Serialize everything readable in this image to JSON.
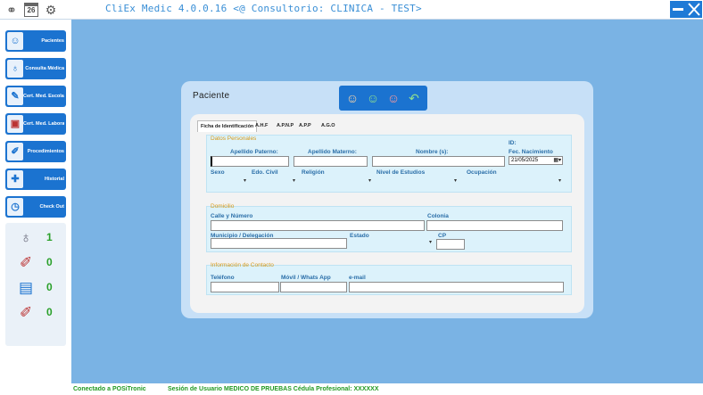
{
  "titlebar": {
    "title": "CliEx Medic 4.0.0.16 <@ Consultorio: CLINICA - TEST>",
    "calendar_day": "26",
    "minimize_icon": "minimize-icon",
    "close_icon": "close-icon"
  },
  "sidebar": {
    "items": [
      {
        "label": "Pacientes",
        "icon": "patient-icon"
      },
      {
        "label": "Consulta Médica",
        "icon": "stethoscope-icon"
      },
      {
        "label": "Cert. Med. Escolar",
        "icon": "school-certificate-icon"
      },
      {
        "label": "Cert. Med. Laboral",
        "icon": "briefcase-icon"
      },
      {
        "label": "Procedimientos",
        "icon": "syringe-icon"
      },
      {
        "label": "Historial",
        "icon": "history-icon"
      },
      {
        "label": "Check Out",
        "icon": "clock-icon"
      }
    ],
    "stats": [
      {
        "value": "1",
        "icon": "stethoscope-icon"
      },
      {
        "value": "0",
        "icon": "syringe-icon"
      },
      {
        "value": "0",
        "icon": "id-card-icon"
      },
      {
        "value": "0",
        "icon": "injection-icon"
      }
    ]
  },
  "panel": {
    "title": "Paciente",
    "toolbar": [
      "new-patient-icon",
      "save-patient-icon",
      "delete-patient-icon",
      "undo-icon"
    ],
    "tabs": [
      "Ficha de Identificación",
      "A.H.F",
      "A.P.N.P",
      "A.P.P",
      "A.G.O"
    ],
    "datos_personales": {
      "title": "Datos Personales",
      "id_label": "ID:",
      "apellido_paterno": "Apellido Paterno:",
      "apellido_materno": "Apellido Materno:",
      "nombres": "Nombre (s):",
      "fec_nacimiento": "Fec. Nacimiento",
      "fec_nacimiento_value": "21/05/2025",
      "sexo": "Sexo",
      "edo_civil": "Edo. Civil",
      "religion": "Religión",
      "nivel_estudios": "Nivel de Estudios",
      "ocupacion": "Ocupación"
    },
    "domicilio": {
      "title": "Domicilio",
      "calle": "Calle y Número",
      "colonia": "Colonia",
      "municipio": "Municipio / Delegación",
      "estado": "Estado",
      "cp": "CP"
    },
    "contacto": {
      "title": "Información de Contacto",
      "telefono": "Teléfono",
      "movil": "Móvil / Whats App",
      "email": "e-mail"
    }
  },
  "footer": {
    "connection": "Conectado a POSiTronic",
    "session": "Sesión de Usuario MEDICO DE PRUEBAS Cédula Profesional: XXXXXX"
  }
}
